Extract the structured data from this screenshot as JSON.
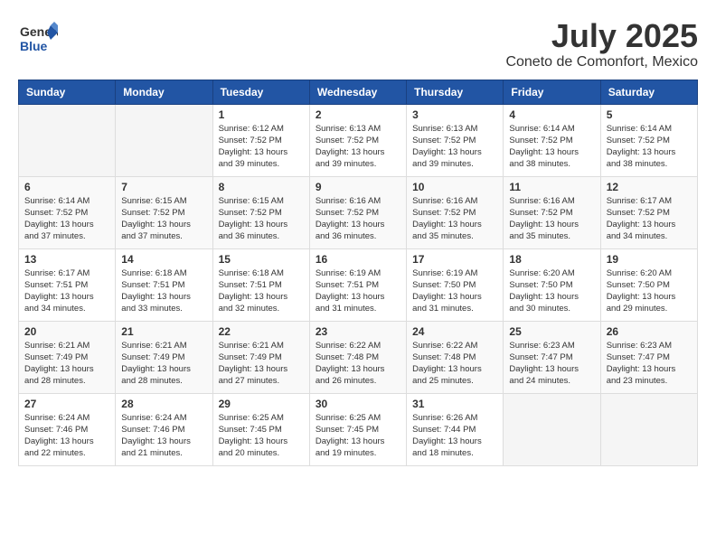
{
  "logo": {
    "general": "General",
    "blue": "Blue"
  },
  "title": "July 2025",
  "location": "Coneto de Comonfort, Mexico",
  "weekdays": [
    "Sunday",
    "Monday",
    "Tuesday",
    "Wednesday",
    "Thursday",
    "Friday",
    "Saturday"
  ],
  "weeks": [
    [
      {
        "day": "",
        "info": ""
      },
      {
        "day": "",
        "info": ""
      },
      {
        "day": "1",
        "info": "Sunrise: 6:12 AM\nSunset: 7:52 PM\nDaylight: 13 hours and 39 minutes."
      },
      {
        "day": "2",
        "info": "Sunrise: 6:13 AM\nSunset: 7:52 PM\nDaylight: 13 hours and 39 minutes."
      },
      {
        "day": "3",
        "info": "Sunrise: 6:13 AM\nSunset: 7:52 PM\nDaylight: 13 hours and 39 minutes."
      },
      {
        "day": "4",
        "info": "Sunrise: 6:14 AM\nSunset: 7:52 PM\nDaylight: 13 hours and 38 minutes."
      },
      {
        "day": "5",
        "info": "Sunrise: 6:14 AM\nSunset: 7:52 PM\nDaylight: 13 hours and 38 minutes."
      }
    ],
    [
      {
        "day": "6",
        "info": "Sunrise: 6:14 AM\nSunset: 7:52 PM\nDaylight: 13 hours and 37 minutes."
      },
      {
        "day": "7",
        "info": "Sunrise: 6:15 AM\nSunset: 7:52 PM\nDaylight: 13 hours and 37 minutes."
      },
      {
        "day": "8",
        "info": "Sunrise: 6:15 AM\nSunset: 7:52 PM\nDaylight: 13 hours and 36 minutes."
      },
      {
        "day": "9",
        "info": "Sunrise: 6:16 AM\nSunset: 7:52 PM\nDaylight: 13 hours and 36 minutes."
      },
      {
        "day": "10",
        "info": "Sunrise: 6:16 AM\nSunset: 7:52 PM\nDaylight: 13 hours and 35 minutes."
      },
      {
        "day": "11",
        "info": "Sunrise: 6:16 AM\nSunset: 7:52 PM\nDaylight: 13 hours and 35 minutes."
      },
      {
        "day": "12",
        "info": "Sunrise: 6:17 AM\nSunset: 7:52 PM\nDaylight: 13 hours and 34 minutes."
      }
    ],
    [
      {
        "day": "13",
        "info": "Sunrise: 6:17 AM\nSunset: 7:51 PM\nDaylight: 13 hours and 34 minutes."
      },
      {
        "day": "14",
        "info": "Sunrise: 6:18 AM\nSunset: 7:51 PM\nDaylight: 13 hours and 33 minutes."
      },
      {
        "day": "15",
        "info": "Sunrise: 6:18 AM\nSunset: 7:51 PM\nDaylight: 13 hours and 32 minutes."
      },
      {
        "day": "16",
        "info": "Sunrise: 6:19 AM\nSunset: 7:51 PM\nDaylight: 13 hours and 31 minutes."
      },
      {
        "day": "17",
        "info": "Sunrise: 6:19 AM\nSunset: 7:50 PM\nDaylight: 13 hours and 31 minutes."
      },
      {
        "day": "18",
        "info": "Sunrise: 6:20 AM\nSunset: 7:50 PM\nDaylight: 13 hours and 30 minutes."
      },
      {
        "day": "19",
        "info": "Sunrise: 6:20 AM\nSunset: 7:50 PM\nDaylight: 13 hours and 29 minutes."
      }
    ],
    [
      {
        "day": "20",
        "info": "Sunrise: 6:21 AM\nSunset: 7:49 PM\nDaylight: 13 hours and 28 minutes."
      },
      {
        "day": "21",
        "info": "Sunrise: 6:21 AM\nSunset: 7:49 PM\nDaylight: 13 hours and 28 minutes."
      },
      {
        "day": "22",
        "info": "Sunrise: 6:21 AM\nSunset: 7:49 PM\nDaylight: 13 hours and 27 minutes."
      },
      {
        "day": "23",
        "info": "Sunrise: 6:22 AM\nSunset: 7:48 PM\nDaylight: 13 hours and 26 minutes."
      },
      {
        "day": "24",
        "info": "Sunrise: 6:22 AM\nSunset: 7:48 PM\nDaylight: 13 hours and 25 minutes."
      },
      {
        "day": "25",
        "info": "Sunrise: 6:23 AM\nSunset: 7:47 PM\nDaylight: 13 hours and 24 minutes."
      },
      {
        "day": "26",
        "info": "Sunrise: 6:23 AM\nSunset: 7:47 PM\nDaylight: 13 hours and 23 minutes."
      }
    ],
    [
      {
        "day": "27",
        "info": "Sunrise: 6:24 AM\nSunset: 7:46 PM\nDaylight: 13 hours and 22 minutes."
      },
      {
        "day": "28",
        "info": "Sunrise: 6:24 AM\nSunset: 7:46 PM\nDaylight: 13 hours and 21 minutes."
      },
      {
        "day": "29",
        "info": "Sunrise: 6:25 AM\nSunset: 7:45 PM\nDaylight: 13 hours and 20 minutes."
      },
      {
        "day": "30",
        "info": "Sunrise: 6:25 AM\nSunset: 7:45 PM\nDaylight: 13 hours and 19 minutes."
      },
      {
        "day": "31",
        "info": "Sunrise: 6:26 AM\nSunset: 7:44 PM\nDaylight: 13 hours and 18 minutes."
      },
      {
        "day": "",
        "info": ""
      },
      {
        "day": "",
        "info": ""
      }
    ]
  ]
}
